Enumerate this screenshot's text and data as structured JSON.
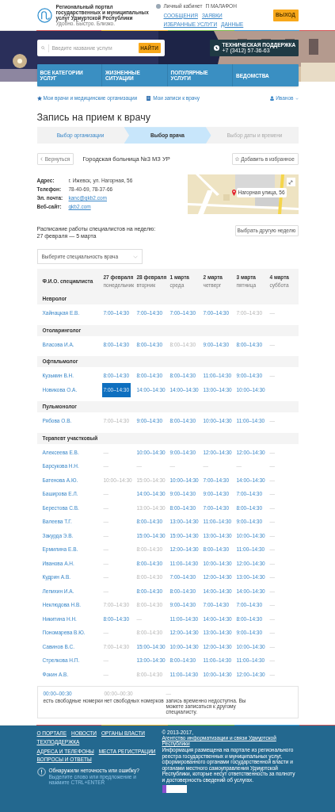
{
  "header": {
    "logo_title": "Региональный портал государственных и муниципальных услуг Удмуртской Республики",
    "tagline": "Удобно. Быстро. Близко.",
    "account_link": "Личный кабинет",
    "user_login": "П МАЛАФОН",
    "menu": [
      "СООБЩЕНИЯ",
      "ЗАЯВКИ",
      "ИЗБРАННЫЕ УСЛУГИ",
      "ДАННЫЕ"
    ],
    "logout": "ВЫХОД"
  },
  "banner": {
    "search": {
      "placeholder": "Введите название услуги"
    },
    "search_button": "НАЙТИ",
    "support_label": "ТЕХНИЧЕСКАЯ ПОДДЕРЖКА",
    "support_phone": "+7 (3412) 57-36-63",
    "nav": [
      "ВСЕ КАТЕГОРИИ УСЛУГ",
      "ЖИЗНЕННЫЕ СИТУАЦИИ",
      "ПОПУЛЯРНЫЕ УСЛУГИ",
      "ВЕДОМСТВА"
    ]
  },
  "sublinks": {
    "doctors": "Мои врачи и медицинские организации",
    "appointments": "Мои записи к врачу",
    "user": "Иванов"
  },
  "title": "Запись на прием к врачу",
  "steps": [
    {
      "label": "Выбор организации",
      "selected": false,
      "completed": true
    },
    {
      "label": "Выбор врача",
      "selected": true,
      "completed": false
    },
    {
      "label": "Выбор даты и времени",
      "selected": false,
      "completed": false
    }
  ],
  "back_button": "Вернуться",
  "organization": "Городская больница №3 МЗ УР",
  "favorite_button": "Добавить в избранное",
  "contacts": [
    {
      "label": "Адрес:",
      "value": "г. Ижевск, ул. Нагорная, 56",
      "kind": "text"
    },
    {
      "label": "Телефон:",
      "value": "78-40-69, 78-37-66",
      "kind": "text"
    },
    {
      "label": "Эл. почта:",
      "value": "kanc@gkb2.com",
      "kind": "link"
    },
    {
      "label": "Веб-сайт:",
      "value": "gkb2.com",
      "kind": "link"
    }
  ],
  "map": {
    "kind": "picture",
    "marker_label": "Нагорная улица, 56"
  },
  "schedule_title_1": "Расписание работы специалистов на неделю:",
  "schedule_title_2": "27 февраля — 5 марта",
  "other_week_button": "Выбрать другую неделю",
  "specialty_select": {
    "placeholder": "Выберите специальность врача"
  },
  "table": {
    "name_column": "Ф.И.О. специалиста",
    "days": [
      {
        "date": "27 февраля",
        "weekday": "понедельник"
      },
      {
        "date": "28 февраля",
        "weekday": "вторник"
      },
      {
        "date": "1 марта",
        "weekday": "среда"
      },
      {
        "date": "2 марта",
        "weekday": "четверг"
      },
      {
        "date": "3 марта",
        "weekday": "пятница"
      },
      {
        "date": "4 марта",
        "weekday": "суббота"
      }
    ],
    "groups": [
      {
        "name": "Невролог",
        "doctors": [
          {
            "name": "Хайнацкая Е.В.",
            "cells": [
              {
                "text": "7:00–14:30",
                "kind": "free"
              },
              {
                "text": "7:00–14:30",
                "kind": "free"
              },
              {
                "text": "7:00–14:30",
                "kind": "free"
              },
              {
                "text": "7:00–14:30",
                "kind": "free"
              },
              {
                "text": "7:00–14:30",
                "kind": "busy"
              },
              {
                "text": "—",
                "kind": "none"
              }
            ]
          }
        ]
      },
      {
        "name": "Отоларинголог",
        "doctors": [
          {
            "name": "Власова И.А.",
            "cells": [
              {
                "text": "8:00–14:30",
                "kind": "free"
              },
              {
                "text": "8:00–14:30",
                "kind": "free"
              },
              {
                "text": "8:00–14:30",
                "kind": "busy"
              },
              {
                "text": "9:00–14:30",
                "kind": "free"
              },
              {
                "text": "8:00–14:30",
                "kind": "free"
              },
              {
                "text": "—",
                "kind": "none"
              }
            ]
          }
        ]
      },
      {
        "name": "Офтальмолог",
        "doctors": [
          {
            "name": "Кузьмин В.Н.",
            "cells": [
              {
                "text": "8:00–14:30",
                "kind": "free"
              },
              {
                "text": "8:00–14:30",
                "kind": "free"
              },
              {
                "text": "8:00–14:30",
                "kind": "free"
              },
              {
                "text": "11:00–14:30",
                "kind": "free"
              },
              {
                "text": "9:00–14:30",
                "kind": "free"
              },
              {
                "text": "—",
                "kind": "none"
              }
            ]
          },
          {
            "name": "Новикова О.А.",
            "cells": [
              {
                "text": "7:00–14:30",
                "kind": "selected"
              },
              {
                "text": "14:00–14:30",
                "kind": "free"
              },
              {
                "text": "14:00–14:30",
                "kind": "free"
              },
              {
                "text": "13:00–14:30",
                "kind": "free"
              },
              {
                "text": "10:00–14:30",
                "kind": "free"
              }
            ]
          }
        ]
      },
      {
        "name": "Пульмонолог",
        "doctors": [
          {
            "name": "Рябова О.В.",
            "cells": [
              {
                "text": "7:00–14:30",
                "kind": "busy"
              },
              {
                "text": "9:00–14:30",
                "kind": "free"
              },
              {
                "text": "8:00–14:30",
                "kind": "free"
              },
              {
                "text": "10:00–14:30",
                "kind": "free"
              },
              {
                "text": "11:00–14:30",
                "kind": "free"
              },
              {
                "text": "—",
                "kind": "none"
              }
            ]
          }
        ]
      },
      {
        "name": "Терапевт участковый",
        "doctors": [
          {
            "name": "Алексеева Е.В.",
            "cells": [
              {
                "text": "—",
                "kind": "none"
              },
              {
                "text": "10:00–14:30",
                "kind": "free"
              },
              {
                "text": "9:00–14:30",
                "kind": "free"
              },
              {
                "text": "12:00–14:30",
                "kind": "free"
              },
              {
                "text": "12:00–14:30",
                "kind": "free"
              },
              {
                "text": "—",
                "kind": "none"
              }
            ]
          },
          {
            "name": "Барсукова Н.Н.",
            "cells": [
              {
                "text": "—",
                "kind": "none"
              },
              {
                "text": "—",
                "kind": "none"
              },
              {
                "text": "—",
                "kind": "none"
              },
              {
                "text": "—",
                "kind": "none"
              },
              {
                "text": "—",
                "kind": "none"
              },
              {
                "text": "—",
                "kind": "none"
              }
            ]
          },
          {
            "name": "Батенова А.Ю.",
            "cells": [
              {
                "text": "10:00–14:30",
                "kind": "busy"
              },
              {
                "text": "15:00–14:30",
                "kind": "busy"
              },
              {
                "text": "10:00–14:30",
                "kind": "free"
              },
              {
                "text": "7:00–14:30",
                "kind": "free"
              },
              {
                "text": "14:00–14:30",
                "kind": "free"
              },
              {
                "text": "—",
                "kind": "none"
              }
            ]
          },
          {
            "name": "Баширова Е.Л.",
            "cells": [
              {
                "text": "—",
                "kind": "none"
              },
              {
                "text": "14:00–14:30",
                "kind": "free"
              },
              {
                "text": "9:00–14:30",
                "kind": "free"
              },
              {
                "text": "9:00–14:30",
                "kind": "free"
              },
              {
                "text": "7:00–14:30",
                "kind": "free"
              },
              {
                "text": "—",
                "kind": "none"
              }
            ]
          },
          {
            "name": "Берестова С.В.",
            "cells": [
              {
                "text": "—",
                "kind": "none"
              },
              {
                "text": "13:00–14:30",
                "kind": "busy"
              },
              {
                "text": "8:00–14:30",
                "kind": "free"
              },
              {
                "text": "7:00–14:30",
                "kind": "free"
              },
              {
                "text": "8:00–14:30",
                "kind": "free"
              },
              {
                "text": "—",
                "kind": "none"
              }
            ]
          },
          {
            "name": "Валеева Т.Г.",
            "cells": [
              {
                "text": "—",
                "kind": "none"
              },
              {
                "text": "8:00–14:30",
                "kind": "free"
              },
              {
                "text": "13:00–14:30",
                "kind": "free"
              },
              {
                "text": "11:00–14:30",
                "kind": "free"
              },
              {
                "text": "9:00–14:30",
                "kind": "free"
              },
              {
                "text": "—",
                "kind": "none"
              }
            ]
          },
          {
            "name": "Закурда Э.В.",
            "cells": [
              {
                "text": "—",
                "kind": "none"
              },
              {
                "text": "15:00–14:30",
                "kind": "free"
              },
              {
                "text": "15:00–14:30",
                "kind": "free"
              },
              {
                "text": "13:00–14:30",
                "kind": "free"
              },
              {
                "text": "10:00–14:30",
                "kind": "free"
              },
              {
                "text": "—",
                "kind": "none"
              }
            ]
          },
          {
            "name": "Ермилина Е.В.",
            "cells": [
              {
                "text": "—",
                "kind": "none"
              },
              {
                "text": "8:00–14:30",
                "kind": "busy"
              },
              {
                "text": "12:00–14:30",
                "kind": "free"
              },
              {
                "text": "8:00–14:30",
                "kind": "free"
              },
              {
                "text": "11:00–14:30",
                "kind": "free"
              },
              {
                "text": "—",
                "kind": "none"
              }
            ]
          },
          {
            "name": "Иванова А.Н.",
            "cells": [
              {
                "text": "—",
                "kind": "none"
              },
              {
                "text": "8:00–14:30",
                "kind": "free"
              },
              {
                "text": "11:00–14:30",
                "kind": "free"
              },
              {
                "text": "10:00–14:30",
                "kind": "free"
              },
              {
                "text": "12:00–14:30",
                "kind": "free"
              },
              {
                "text": "—",
                "kind": "none"
              }
            ]
          },
          {
            "name": "Кудрин А.В.",
            "cells": [
              {
                "text": "—",
                "kind": "none"
              },
              {
                "text": "8:00–14:30",
                "kind": "busy"
              },
              {
                "text": "7:00–14:30",
                "kind": "free"
              },
              {
                "text": "12:00–14:30",
                "kind": "free"
              },
              {
                "text": "13:00–14:30",
                "kind": "free"
              },
              {
                "text": "—",
                "kind": "none"
              }
            ]
          },
          {
            "name": "Лепихин И.А.",
            "cells": [
              {
                "text": "—",
                "kind": "none"
              },
              {
                "text": "8:00–14:30",
                "kind": "free"
              },
              {
                "text": "8:00–14:30",
                "kind": "free"
              },
              {
                "text": "14:00–14:30",
                "kind": "free"
              },
              {
                "text": "14:00–14:30",
                "kind": "free"
              },
              {
                "text": "—",
                "kind": "none"
              }
            ]
          },
          {
            "name": "Неклюдова Н.В.",
            "cells": [
              {
                "text": "7:00–14:30",
                "kind": "busy"
              },
              {
                "text": "8:00–14:30",
                "kind": "busy"
              },
              {
                "text": "9:00–14:30",
                "kind": "free"
              },
              {
                "text": "7:00–14:30",
                "kind": "free"
              },
              {
                "text": "7:00–14:30",
                "kind": "free"
              },
              {
                "text": "—",
                "kind": "none"
              }
            ]
          },
          {
            "name": "Никитина Н.Н.",
            "cells": [
              {
                "text": "8:00–14:30",
                "kind": "free"
              },
              {
                "text": "—",
                "kind": "none"
              },
              {
                "text": "11:00–14:30",
                "kind": "free"
              },
              {
                "text": "14:00–14:30",
                "kind": "free"
              },
              {
                "text": "8:00–14:30",
                "kind": "free"
              },
              {
                "text": "—",
                "kind": "none"
              }
            ]
          },
          {
            "name": "Пономарева В.Ю.",
            "cells": [
              {
                "text": "—",
                "kind": "none"
              },
              {
                "text": "8:00–14:30",
                "kind": "busy"
              },
              {
                "text": "12:00–14:30",
                "kind": "free"
              },
              {
                "text": "13:00–14:30",
                "kind": "free"
              },
              {
                "text": "9:00–14:30",
                "kind": "free"
              },
              {
                "text": "—",
                "kind": "none"
              }
            ]
          },
          {
            "name": "Савинов В.С.",
            "cells": [
              {
                "text": "7:00–14:30",
                "kind": "busy"
              },
              {
                "text": "15:00–14:30",
                "kind": "free"
              },
              {
                "text": "10:00–14:30",
                "kind": "free"
              },
              {
                "text": "12:00–14:30",
                "kind": "free"
              },
              {
                "text": "10:00–14:30",
                "kind": "free"
              },
              {
                "text": "—",
                "kind": "none"
              }
            ]
          },
          {
            "name": "Стрелкова Н.П.",
            "cells": [
              {
                "text": "—",
                "kind": "none"
              },
              {
                "text": "13:00–14:30",
                "kind": "free"
              },
              {
                "text": "8:00–14:30",
                "kind": "free"
              },
              {
                "text": "11:00–14:30",
                "kind": "free"
              },
              {
                "text": "11:00–14:30",
                "kind": "free"
              },
              {
                "text": "—",
                "kind": "none"
              }
            ]
          },
          {
            "name": "Фокин А.В.",
            "cells": [
              {
                "text": "—",
                "kind": "none"
              },
              {
                "text": "8:00–14:30",
                "kind": "busy"
              },
              {
                "text": "11:00–14:30",
                "kind": "free"
              },
              {
                "text": "10:00–14:30",
                "kind": "free"
              },
              {
                "text": "12:00–14:30",
                "kind": "free"
              },
              {
                "text": "—",
                "kind": "none"
              }
            ]
          }
        ]
      }
    ]
  },
  "legend": [
    {
      "sample": "00:00–00:30",
      "kind": "free",
      "text": "есть свободные номерки"
    },
    {
      "sample": "00:00–00:30",
      "kind": "busy",
      "text": "нет свободных номерков"
    },
    {
      "sample": "—",
      "kind": "none",
      "text": "запись временно недоступна. Вы можете записаться к другому специалисту."
    }
  ],
  "footer": {
    "links": [
      [
        "О ПОРТАЛЕ",
        "НОВОСТИ",
        "ОРГАНЫ ВЛАСТИ",
        "ТЕХПОДДЕРЖКА"
      ],
      [
        "АДРЕСА И ТЕЛЕФОНЫ",
        "МЕСТА РЕГИСТРАЦИИ",
        "ВОПРОСЫ И ОТВЕТЫ"
      ]
    ],
    "error_title": "Обнаружили неточность или ошибку?",
    "error_hint": "Выделите слово или предложение и нажмите CTRL+ENTER",
    "copyright": "© 2013-2017,",
    "agency": "Агентство информатизации и связи Удмуртской Республики",
    "disclaimer": "Информация размещена на портале из регионального реестра государственных и муниципальных услуг, сформированного органами государственной власти и органами местного самоуправления Удмуртской Республики, которые несут ответственность за полноту и достоверность сведений об услугах."
  }
}
